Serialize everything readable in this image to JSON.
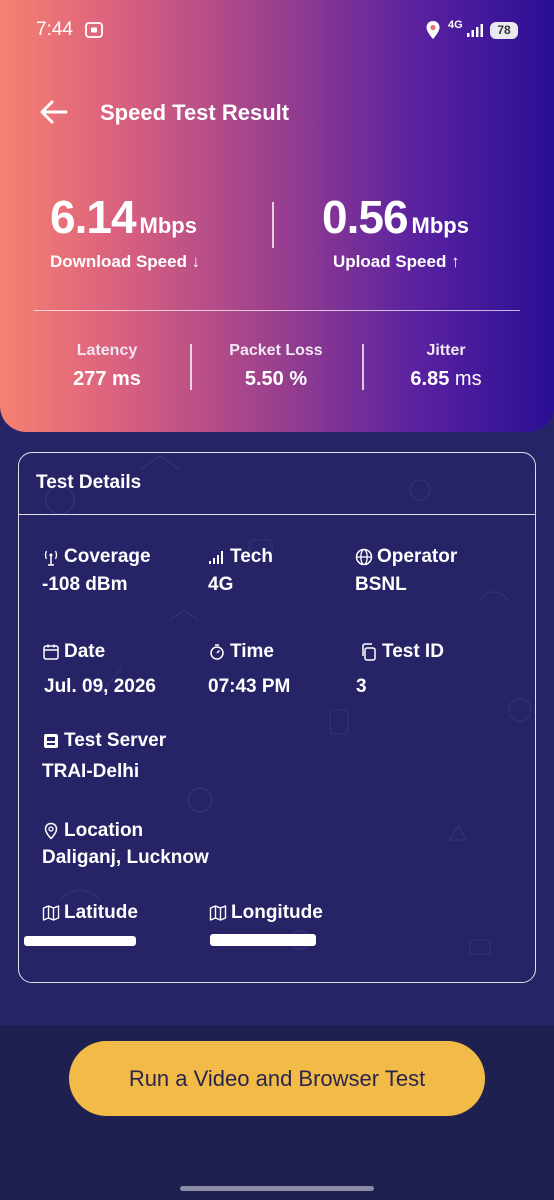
{
  "status_bar": {
    "time": "7:44",
    "network": "4G",
    "battery": "78"
  },
  "header": {
    "title": "Speed Test Result"
  },
  "download": {
    "value": "6.14",
    "unit": "Mbps",
    "label": "Download Speed ↓"
  },
  "upload": {
    "value": "0.56",
    "unit": "Mbps",
    "label": "Upload Speed ↑"
  },
  "metrics": [
    {
      "label": "Latency",
      "value": "277",
      "unit": "ms"
    },
    {
      "label": "Packet Loss",
      "value": "5.50",
      "unit": "%"
    },
    {
      "label": "Jitter",
      "value": "6.85",
      "unit": "ms"
    }
  ],
  "details": {
    "heading": "Test Details",
    "coverage": {
      "label": "Coverage",
      "value": "-108 dBm",
      "icon": "antenna-icon"
    },
    "tech": {
      "label": "Tech",
      "value": "4G",
      "icon": "signal-bars-icon"
    },
    "operator": {
      "label": "Operator",
      "value": "BSNL",
      "icon": "globe-icon"
    },
    "date": {
      "label": "Date",
      "value": "Jul. 09, 2026",
      "icon": "calendar-icon"
    },
    "time": {
      "label": "Time",
      "value": "07:43 PM",
      "icon": "timer-icon"
    },
    "test_id": {
      "label": "Test ID",
      "value": "3",
      "icon": "copy-icon"
    },
    "server": {
      "label": "Test Server",
      "value": "TRAI-Delhi",
      "icon": "server-icon"
    },
    "location": {
      "label": "Location",
      "value": "Daliganj, Lucknow",
      "icon": "location-pin-icon"
    },
    "latitude": {
      "label": "Latitude",
      "icon": "map-icon"
    },
    "longitude": {
      "label": "Longitude",
      "icon": "map-icon"
    }
  },
  "action": {
    "button_label": "Run a Video and Browser Test",
    "button_color": "#f2bb47"
  },
  "colors": {
    "gradient_start": "#f68170",
    "gradient_end": "#2a0e94",
    "background": "#262367"
  }
}
